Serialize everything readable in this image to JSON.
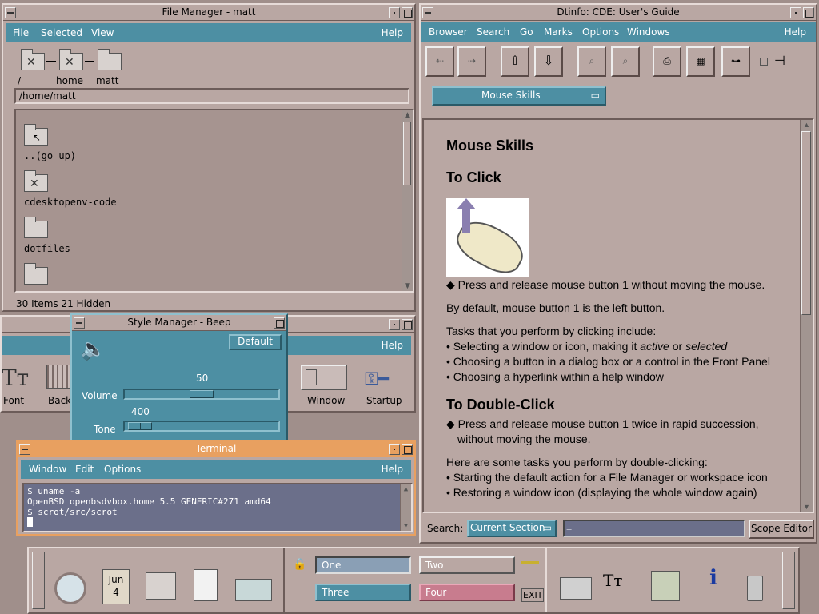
{
  "file_manager": {
    "title": "File Manager - matt",
    "menu": [
      "File",
      "Selected",
      "View"
    ],
    "help": "Help",
    "path_labels": [
      "/",
      "home",
      "matt"
    ],
    "current_path": "/home/matt",
    "items": [
      "..(go up)",
      "cdesktopenv-code",
      "dotfiles"
    ],
    "status": "30 Items 21 Hidden"
  },
  "style_behind": {
    "help": "Help",
    "icons": [
      "Font",
      "Back",
      "Window",
      "Startup"
    ],
    "icon_glyph": "Tт"
  },
  "style_beep": {
    "title": "Style Manager - Beep",
    "default_label": "Default",
    "volume_label": "Volume",
    "volume_value": "50",
    "volume_level": 0.5,
    "tone_label": "Tone",
    "tone_value": "400",
    "tone_level": 0.05
  },
  "terminal": {
    "title": "Terminal",
    "menu": [
      "Window",
      "Edit",
      "Options"
    ],
    "help": "Help",
    "lines": [
      "$ uname -a",
      "OpenBSD openbsdvbox.home 5.5 GENERIC#271 amd64",
      "$ scrot/src/scrot"
    ]
  },
  "dtinfo": {
    "title": "Dtinfo: CDE: User's Guide",
    "menu": [
      "Browser",
      "Search",
      "Go",
      "Marks",
      "Options",
      "Windows"
    ],
    "help": "Help",
    "section_selector": "Mouse Skills",
    "heading": "Mouse Skills",
    "click_heading": "To Click",
    "click_bullet": "Press and release mouse button 1 without moving the mouse.",
    "default_text": "By default, mouse button 1 is the left button.",
    "tasks_intro": "Tasks that you perform by clicking include:",
    "task1_pre": "Selecting a window or icon, making it ",
    "task1_active": "active",
    "task1_or": " or ",
    "task1_selected": "selected",
    "task2": "Choosing a button in a dialog box or a control in the Front Panel",
    "task3": "Choosing a hyperlink within a help window",
    "dbl_heading": "To Double-Click",
    "dbl_bullet_1": "Press and release mouse button 1 twice in rapid succession,",
    "dbl_bullet_2": "without moving the mouse.",
    "dbl_intro": "Here are some tasks you perform by double-clicking:",
    "dbl_task1": "Starting the default action for a File Manager or workspace icon",
    "dbl_task2": "Restoring a window icon (displaying the whole window again)",
    "search_label": "Search:",
    "search_scope": "Current Section",
    "scope_editor": "Scope Editor"
  },
  "front_panel": {
    "calendar_month": "Jun",
    "calendar_day": "4",
    "workspaces": [
      "One",
      "Two",
      "Three",
      "Four"
    ],
    "exit": "EXIT",
    "icon_glyph": "Tт",
    "colors": {
      "one": "#8a9fb5",
      "two": "#b9a7a3",
      "three": "#4d8fa3",
      "four": "#c87c8e"
    }
  }
}
